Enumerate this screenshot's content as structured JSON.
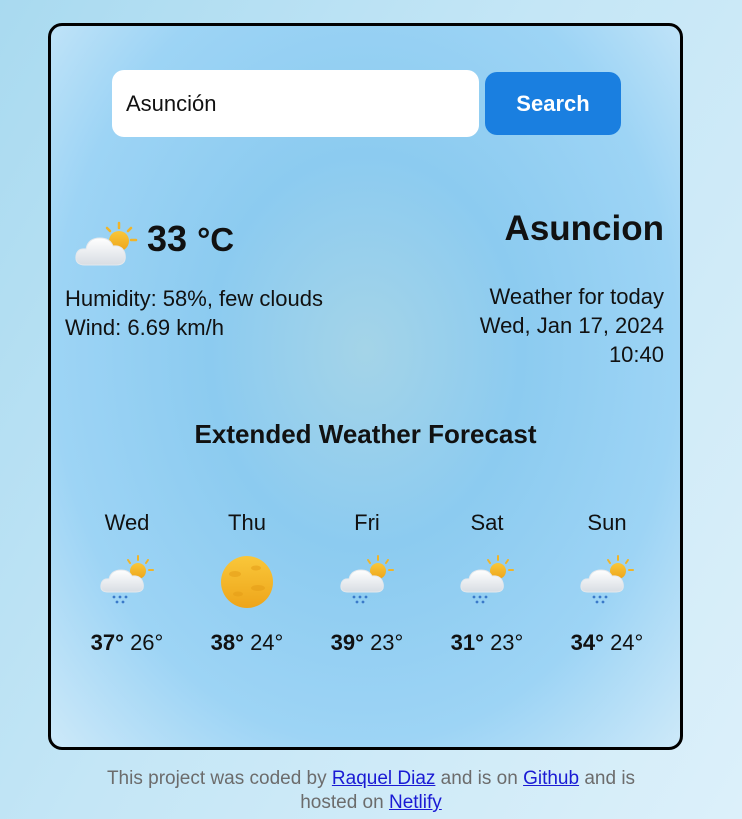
{
  "search": {
    "value": "Asunción",
    "button_label": "Search"
  },
  "current": {
    "icon": "partly-cloudy-icon",
    "temperature": "33",
    "unit": "°C",
    "humidity_line": "Humidity: 58%, few clouds",
    "wind_line": "Wind: 6.69 km/h",
    "city": "Asuncion",
    "subtitle": "Weather for today",
    "date": "Wed, Jan 17, 2024",
    "time": "10:40"
  },
  "forecast": {
    "title": "Extended Weather Forecast",
    "days": [
      {
        "name": "Wed",
        "icon": "rain-cloud-sun-icon",
        "max": "37°",
        "min": "26°"
      },
      {
        "name": "Thu",
        "icon": "sun-icon",
        "max": "38°",
        "min": "24°"
      },
      {
        "name": "Fri",
        "icon": "rain-cloud-sun-icon",
        "max": "39°",
        "min": "23°"
      },
      {
        "name": "Sat",
        "icon": "rain-cloud-sun-icon",
        "max": "31°",
        "min": "23°"
      },
      {
        "name": "Sun",
        "icon": "rain-cloud-sun-icon",
        "max": "34°",
        "min": "24°"
      }
    ]
  },
  "footer": {
    "t1": "This project was coded by ",
    "author": "Raquel Diaz",
    "t2": " and is on ",
    "github": "Github",
    "t3": " and is hosted on ",
    "netlify": "Netlify"
  },
  "colors": {
    "accent": "#1a7fe0",
    "link": "#1a1ad4",
    "footer_text": "#6c6c6c"
  }
}
